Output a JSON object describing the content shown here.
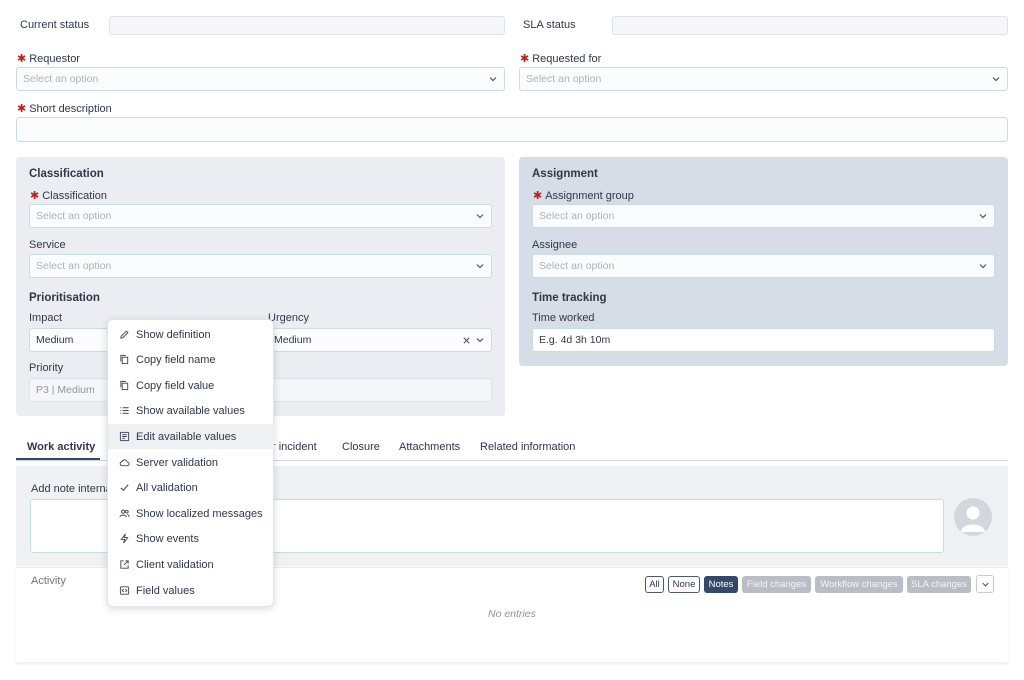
{
  "colors": {
    "accent": "#34486a",
    "field_border": "#c8dde0",
    "required": "#b3261e",
    "assignment_panel": "#d7dde7",
    "classification_panel": "#ecedf3"
  },
  "header": {
    "current_status_label": "Current status",
    "sla_status_label": "SLA status"
  },
  "form": {
    "requestor": {
      "label": "Requestor",
      "placeholder": "Select an option"
    },
    "requested_for": {
      "label": "Requested for",
      "placeholder": "Select an option"
    },
    "short_description": {
      "label": "Short description"
    }
  },
  "classification_panel": {
    "title": "Classification",
    "classification": {
      "label": "Classification",
      "placeholder": "Select an option"
    },
    "service": {
      "label": "Service",
      "placeholder": "Select an option"
    },
    "prioritisation_title": "Prioritisation",
    "impact": {
      "label": "Impact",
      "value": "Medium"
    },
    "urgency": {
      "label": "Urgency",
      "value": "Medium"
    },
    "priority": {
      "label": "Priority",
      "value": "P3 | Medium"
    }
  },
  "assignment_panel": {
    "title": "Assignment",
    "assignment_group": {
      "label": "Assignment group",
      "placeholder": "Select an option"
    },
    "assignee": {
      "label": "Assignee",
      "placeholder": "Select an option"
    },
    "time_tracking_title": "Time tracking",
    "time_worked": {
      "label": "Time worked",
      "value": "E.g. 4d 3h 10m"
    }
  },
  "tabs": [
    {
      "label": "Work activity"
    },
    {
      "label": "r incident"
    },
    {
      "label": "Closure"
    },
    {
      "label": "Attachments"
    },
    {
      "label": "Related information"
    }
  ],
  "work_activity": {
    "note_label": "Add note interna",
    "activity_label": "Activity",
    "empty_text": "No entries",
    "filters": [
      {
        "label": "All"
      },
      {
        "label": "None"
      },
      {
        "label": "Notes"
      },
      {
        "label": "Field changes"
      },
      {
        "label": "Workflow changes"
      },
      {
        "label": "SLA changes"
      }
    ]
  },
  "context_menu": {
    "items": [
      {
        "label": "Show definition",
        "icon": "pencil-icon"
      },
      {
        "label": "Copy field name",
        "icon": "copy-icon"
      },
      {
        "label": "Copy field value",
        "icon": "copy-icon"
      },
      {
        "label": "Show available values",
        "icon": "list-icon"
      },
      {
        "label": "Edit available values",
        "icon": "edit-list-icon"
      },
      {
        "label": "Server validation",
        "icon": "cloud-icon"
      },
      {
        "label": "All validation",
        "icon": "check-icon"
      },
      {
        "label": "Show localized messages",
        "icon": "users-icon"
      },
      {
        "label": "Show events",
        "icon": "bolt-icon"
      },
      {
        "label": "Client validation",
        "icon": "external-link-icon"
      },
      {
        "label": "Field values",
        "icon": "code-icon"
      }
    ]
  }
}
